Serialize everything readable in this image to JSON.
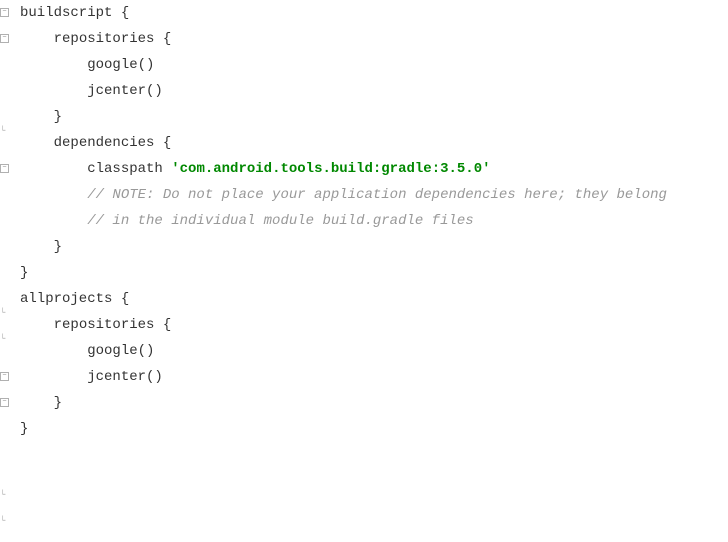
{
  "code": {
    "line1_keyword": "buildscript",
    "line1_brace": " {",
    "line2_keyword": "repositories",
    "line2_brace": " {",
    "line3": "google()",
    "line4": "jcenter()",
    "line5_brace": "}",
    "line6_keyword": "dependencies",
    "line6_brace": " {",
    "line7_keyword": "classpath",
    "line7_space": " ",
    "line7_string": "'com.android.tools.build:gradle:3.5.0'",
    "line8": "",
    "line9_comment": "// NOTE: Do not place your application dependencies here; they belong",
    "line10_comment": "// in the individual module build.gradle files",
    "line11_brace": "}",
    "line12_brace": "}",
    "line13": "",
    "line14_keyword": "allprojects",
    "line14_brace": " {",
    "line15_keyword": "repositories",
    "line15_brace": " {",
    "line16": "google()",
    "line17": "jcenter()",
    "line18_brace": "}",
    "line19_brace": "}"
  }
}
